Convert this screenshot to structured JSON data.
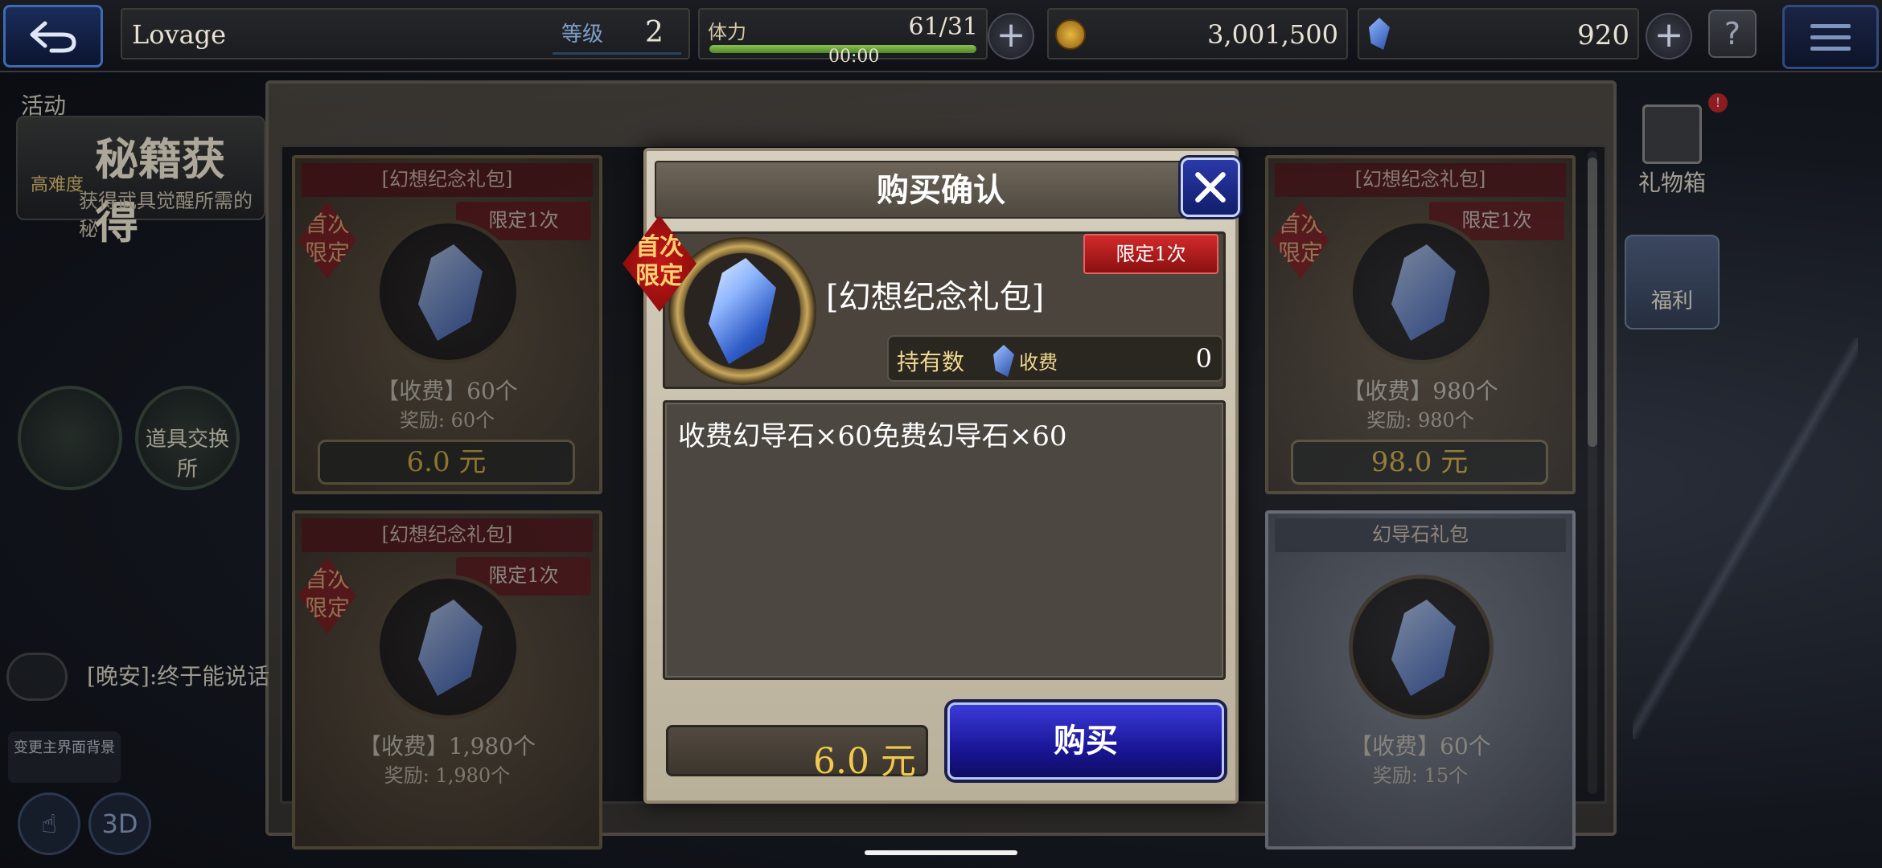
{
  "topbar": {
    "player_name": "Lovage",
    "level_label": "等级",
    "level_value": "2",
    "stamina_label": "体力",
    "stamina_value": "61/31",
    "stamina_fraction": 1.0,
    "stamina_timer": "00:00",
    "gil_value": "3,001,500",
    "gem_value": "920",
    "plus_label": "+",
    "help_label": "?"
  },
  "sidebar_left": {
    "event_label": "活动",
    "banner_prefix": "高难度",
    "banner_title": "秘籍获得",
    "banner_sub": "获得武具觉醒所需的秘",
    "exchange_label": "道具交换所",
    "chat_text": "[晚安]:终于能说话",
    "theme_label": "变更主界面背景",
    "mode_3d": "3D"
  },
  "sidebar_right": {
    "gift_label": "礼物箱",
    "gift_badge": "!",
    "craft_label": "福利"
  },
  "shop": {
    "cards": [
      {
        "title": "[幻想纪念礼包]",
        "limit": "限定1次",
        "first": "首次限定",
        "amount": "【收费】60个",
        "bonus": "奖励: 60个",
        "price": "6.0 元"
      },
      {
        "title": "[幻想纪念礼包]",
        "limit": "限定1次",
        "first": "首次限定",
        "amount": "【收费】980个",
        "bonus": "奖励: 980个",
        "price": "98.0 元"
      },
      {
        "title": "[幻想纪念礼包]",
        "limit": "限定1次",
        "first": "首次限定",
        "amount": "【收费】1,980个",
        "bonus": "奖励: 1,980个",
        "price": ""
      },
      {
        "title": "幻导石礼包",
        "limit": "",
        "first": "",
        "amount": "【收费】60个",
        "bonus": "奖励: 15个",
        "price": ""
      }
    ]
  },
  "dialog": {
    "title": "购买确认",
    "first_badge": "首次限定",
    "limit_badge": "限定1次",
    "item_name": "[幻想纪念礼包]",
    "owned_label": "持有数",
    "owned_kind": "收费",
    "owned_count": "0",
    "description": "收费幻导石×60免费幻导石×60",
    "price": "6.0 元",
    "buy_label": "购买"
  },
  "colors": {
    "accent_blue": "#1a1698",
    "price_gold": "#f2c94c",
    "limit_red": "#d22a2a"
  }
}
